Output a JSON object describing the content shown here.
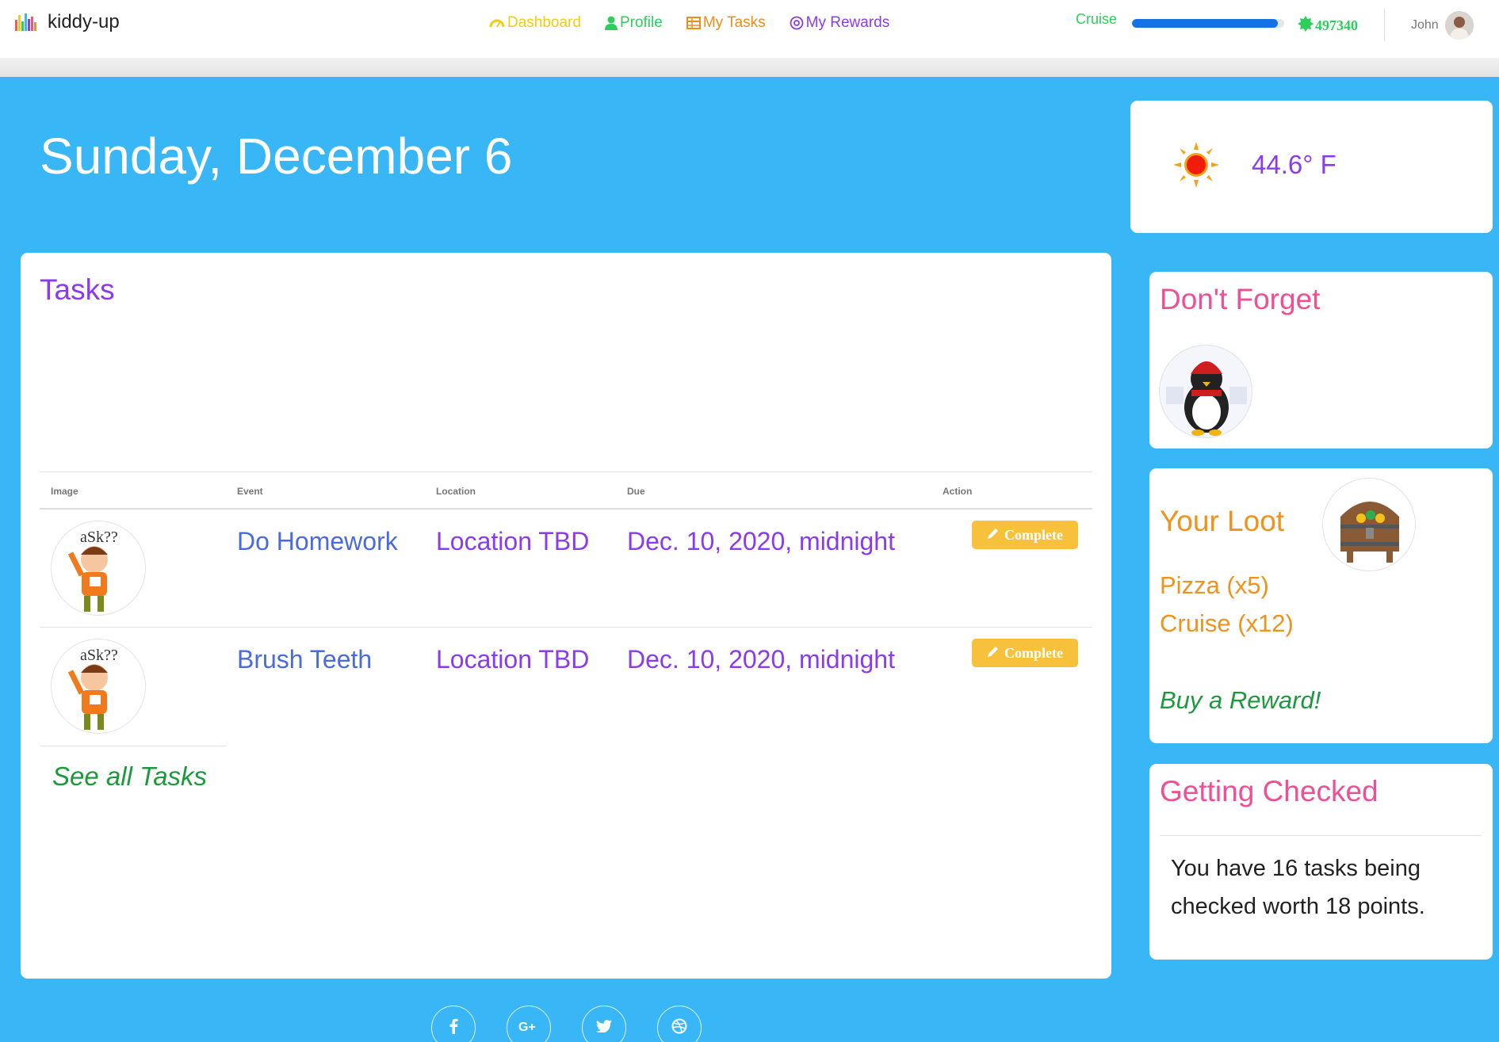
{
  "brand": {
    "name": "kiddy-up"
  },
  "nav": {
    "dashboard": "Dashboard",
    "profile": "Profile",
    "tasks": "My Tasks",
    "rewards": "My Rewards"
  },
  "goal": {
    "label": "Cruise",
    "progress_percent": 96,
    "points": "497340"
  },
  "user": {
    "name": "John"
  },
  "page": {
    "date": "Sunday, December 6"
  },
  "weather": {
    "icon": "sun-icon",
    "temperature": "44.6° F"
  },
  "tasks": {
    "title": "Tasks",
    "columns": [
      "Image",
      "Event",
      "Location",
      "Due",
      "Action"
    ],
    "rows": [
      {
        "event": "Do Homework",
        "location": "Location TBD",
        "due": "Dec. 10, 2020, midnight",
        "action": "Complete"
      },
      {
        "event": "Brush Teeth",
        "location": "Location TBD",
        "due": "Dec. 10, 2020, midnight",
        "action": "Complete"
      }
    ],
    "see_all": "See all Tasks"
  },
  "dont_forget": {
    "title": "Don't Forget"
  },
  "loot": {
    "title": "Your Loot",
    "items": [
      "Pizza (x5)",
      "Cruise (x12)"
    ],
    "buy_link": "Buy a Reward!"
  },
  "getting_checked": {
    "title": "Getting Checked",
    "message": "You have 16 tasks being checked worth 18 points."
  },
  "footer": {
    "social": [
      "facebook-icon",
      "google-plus-icon",
      "twitter-icon",
      "dribbble-icon"
    ]
  },
  "colors": {
    "background": "#38b6f5",
    "purple": "#8a3bf0",
    "pink": "#f04f93",
    "orange": "#f0921c",
    "green": "#1b9a3c",
    "button": "#f7c13b",
    "progress": "#1372e6"
  }
}
